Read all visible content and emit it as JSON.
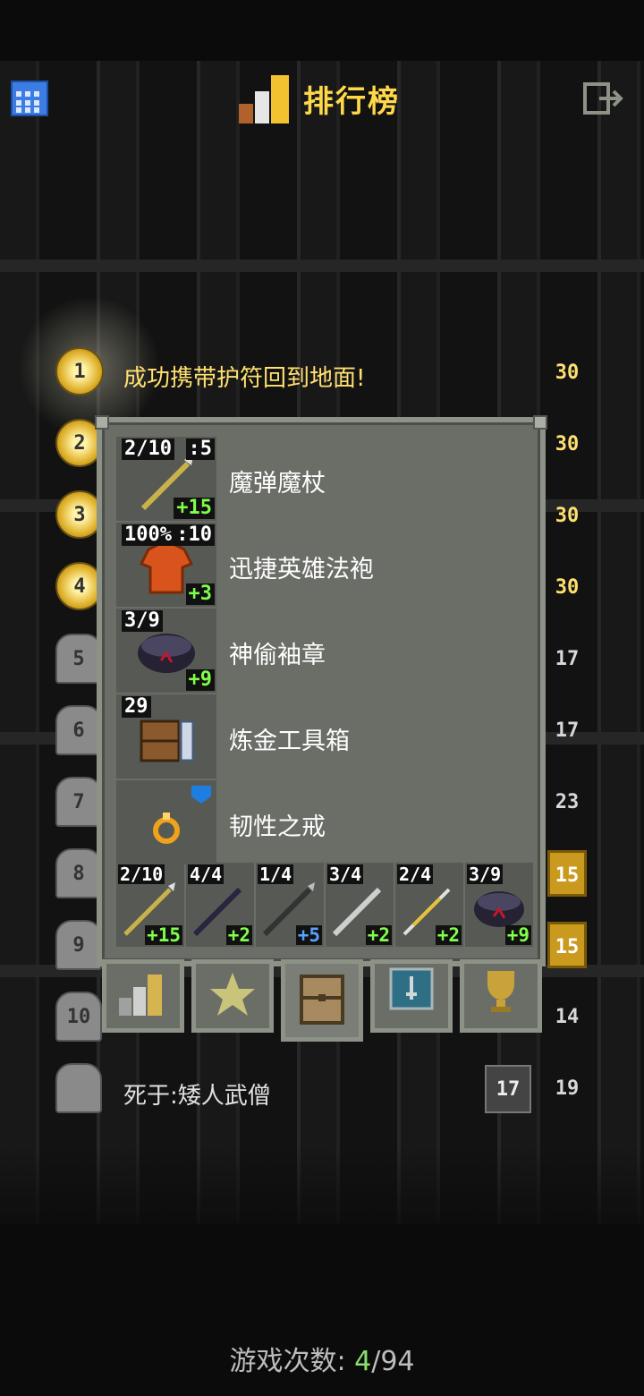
{
  "header": {
    "title": "排行榜",
    "calendar_icon": "calendar-icon",
    "exit_icon": "exit-icon"
  },
  "leaderboard": {
    "first_entry_text": "成功携带护符回到地面!",
    "last_entry_text": "死于:矮人武僧",
    "ranks": [
      "1",
      "2",
      "3",
      "4",
      "5",
      "6",
      "7",
      "8",
      "9",
      "10"
    ],
    "levels": [
      "30",
      "30",
      "30",
      "30",
      "17",
      "17",
      "23",
      "15",
      "15",
      "14",
      "19"
    ],
    "last_depth": "17"
  },
  "equipment": [
    {
      "name": "魔弹魔杖",
      "top_left": "2/10",
      "top_right": ":5",
      "bonus": "+15",
      "icon": "wand-icon"
    },
    {
      "name": "迅捷英雄法袍",
      "top_left": "100%",
      "top_right": ":10",
      "bonus": "+3",
      "icon": "robe-icon"
    },
    {
      "name": "神偷袖章",
      "top_left": "3/9",
      "top_right": "",
      "bonus": "+9",
      "icon": "armband-icon"
    },
    {
      "name": "炼金工具箱",
      "top_left": "29",
      "top_right": "",
      "bonus": "",
      "icon": "alchemy-kit-icon"
    },
    {
      "name": "韧性之戒",
      "top_left": "",
      "top_right": "",
      "bonus": "",
      "icon": "ring-icon"
    }
  ],
  "quickslots": [
    {
      "charges": "2/10",
      "bonus": "+15",
      "bonus_color": "#7fff4a"
    },
    {
      "charges": "4/4",
      "bonus": "+2",
      "bonus_color": "#7fff4a"
    },
    {
      "charges": "1/4",
      "bonus": "+5",
      "bonus_color": "#5aa0ff"
    },
    {
      "charges": "3/4",
      "bonus": "+2",
      "bonus_color": "#7fff4a"
    },
    {
      "charges": "2/4",
      "bonus": "+2",
      "bonus_color": "#7fff4a"
    },
    {
      "charges": "3/9",
      "bonus": "+9",
      "bonus_color": "#7fff4a"
    }
  ],
  "tabs": [
    "stats-tab-icon",
    "badges-tab-icon",
    "items-tab-icon",
    "challenges-tab-icon",
    "trophy-tab-icon"
  ],
  "footer": {
    "label": "游戏次数:",
    "current": "4",
    "total": "/94"
  }
}
